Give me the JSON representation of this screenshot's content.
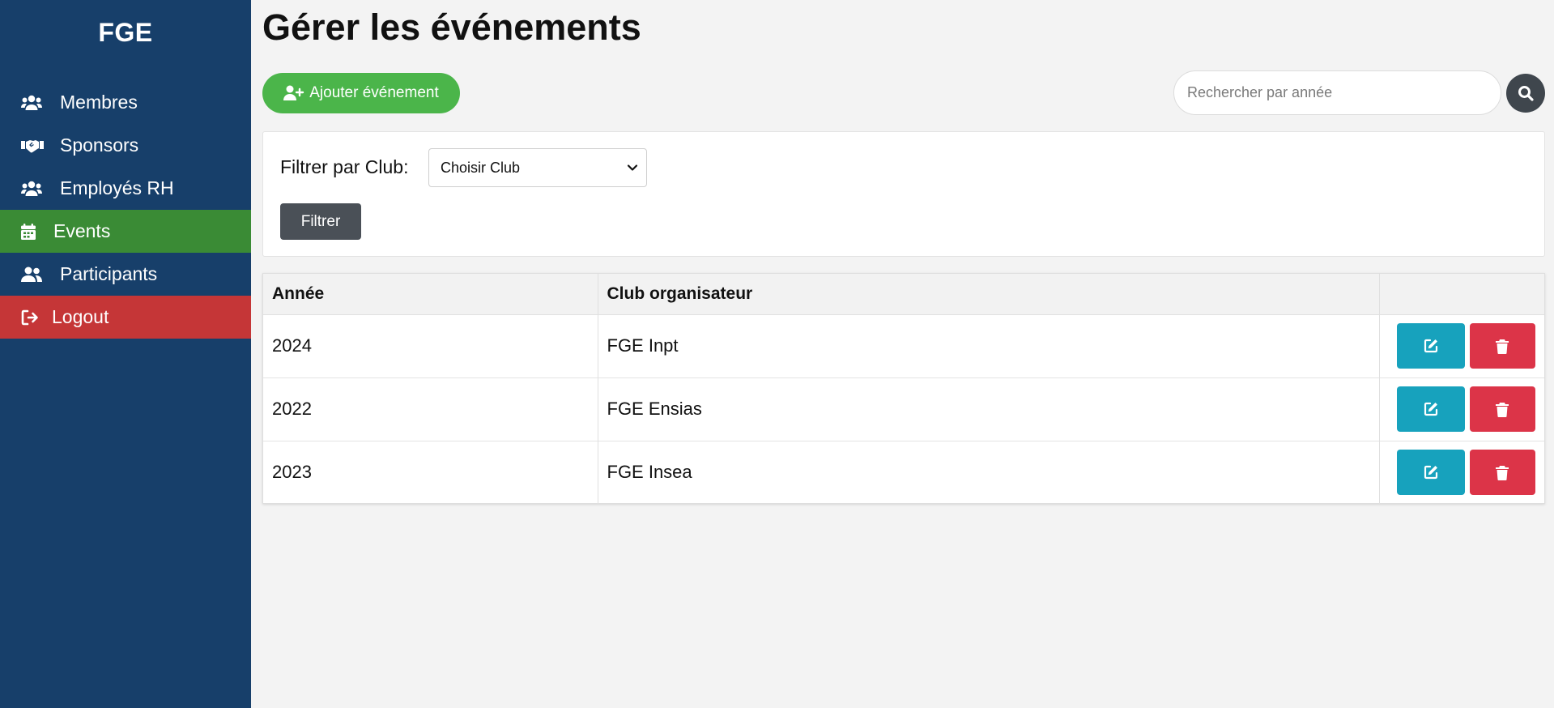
{
  "sidebar": {
    "brand": "FGE",
    "items": [
      {
        "label": "Membres",
        "icon": "users-icon"
      },
      {
        "label": "Sponsors",
        "icon": "handshake-icon"
      },
      {
        "label": "Employés RH",
        "icon": "users-icon"
      },
      {
        "label": "Events",
        "icon": "calendar-icon",
        "active": true
      },
      {
        "label": "Participants",
        "icon": "user-friends-icon"
      },
      {
        "label": "Logout",
        "icon": "sign-out-icon"
      }
    ]
  },
  "main": {
    "title": "Gérer les événements",
    "add_button": "Ajouter événement",
    "search": {
      "placeholder": "Rechercher par année"
    },
    "filter": {
      "label": "Filtrer par Club:",
      "select_value": "Choisir Club",
      "button": "Filtrer"
    },
    "table": {
      "headers": [
        "Année",
        "Club organisateur",
        ""
      ],
      "rows": [
        {
          "year": "2024",
          "club": "FGE Inpt"
        },
        {
          "year": "2022",
          "club": "FGE Ensias"
        },
        {
          "year": "2023",
          "club": "FGE Insea"
        }
      ]
    }
  },
  "colors": {
    "sidebar_bg": "#173f6a",
    "active_item": "#3a8b35",
    "logout": "#c53637",
    "add_button": "#4bb54a",
    "edit_button": "#17a2bd",
    "delete_button": "#dc3448",
    "filter_button": "#4a5057"
  }
}
